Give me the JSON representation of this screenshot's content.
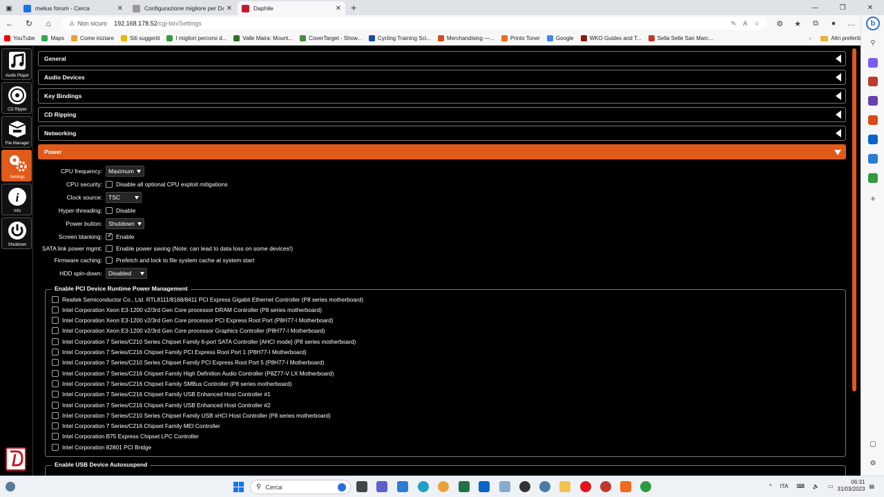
{
  "browser": {
    "tabs": [
      {
        "title": "melius forum - Cerca",
        "icon_color": "#1a73e8"
      },
      {
        "title": "Configurazione migliore per Dap",
        "icon_color": "#999999"
      },
      {
        "title": "Daphile",
        "icon_color": "#c01a2a"
      }
    ],
    "new_tab": "+",
    "address": {
      "not_secure": "Non sicuro",
      "host": "192.168.178.52",
      "path": "/cgi-bin/Settings"
    },
    "bookmarks": [
      {
        "label": "YouTube",
        "color": "#ff0000"
      },
      {
        "label": "Maps",
        "color": "#34a853"
      },
      {
        "label": "Come iniziare",
        "color": "#e8a33a"
      },
      {
        "label": "Siti suggeriti",
        "color": "#f4b400"
      },
      {
        "label": "I migliori percorsi d...",
        "color": "#3a9a3a"
      },
      {
        "label": "Valle Maira: Mount...",
        "color": "#2f6e2f"
      },
      {
        "label": "CoverTarget - Show...",
        "color": "#4a8a4a"
      },
      {
        "label": "Cycling Training Sci...",
        "color": "#1a4fa0"
      },
      {
        "label": "Merchandising —...",
        "color": "#d94a1a"
      },
      {
        "label": "Printo Toner",
        "color": "#f26a1a"
      },
      {
        "label": "Google",
        "color": "#4285f4"
      },
      {
        "label": "WKO Guides and T...",
        "color": "#8a1a1a"
      },
      {
        "label": "Sella Selle San Marc...",
        "color": "#c0392b"
      }
    ],
    "other_bookmarks": "Altri preferiti"
  },
  "nav": {
    "items": [
      {
        "label": "Audio Player",
        "icon": "music-note-icon"
      },
      {
        "label": "CD Ripper",
        "icon": "disc-icon"
      },
      {
        "label": "File Manager",
        "icon": "drive-icon"
      },
      {
        "label": "Settings",
        "icon": "gears-icon",
        "active": true
      },
      {
        "label": "Info",
        "icon": "info-icon"
      },
      {
        "label": "Shutdown",
        "icon": "power-icon"
      }
    ]
  },
  "sections": [
    {
      "title": "General"
    },
    {
      "title": "Audio Devices"
    },
    {
      "title": "Key Bindings"
    },
    {
      "title": "CD Ripping"
    },
    {
      "title": "Networking"
    },
    {
      "title": "Power",
      "open": true
    }
  ],
  "power": {
    "cpu_frequency": {
      "label": "CPU frequency:",
      "value": "Maximum"
    },
    "cpu_security": {
      "label": "CPU security:",
      "text": "Disable all optional CPU exploit mitigations",
      "checked": false
    },
    "clock_source": {
      "label": "Clock source:",
      "value": "TSC"
    },
    "hyper_threading": {
      "label": "Hyper-threading:",
      "text": "Disable",
      "checked": false
    },
    "power_button": {
      "label": "Power button:",
      "value": "Shutdown"
    },
    "screen_blanking": {
      "label": "Screen blanking:",
      "text": "Enable",
      "checked": true
    },
    "sata_link": {
      "label": "SATA link power mgmt:",
      "text": "Enable power saving (Note: can lead to data loss on some devices!)",
      "checked": false
    },
    "firmware_caching": {
      "label": "Firmware caching:",
      "text": "Prefetch and lock to file system cache at system start",
      "checked": false
    },
    "hdd_spin_down": {
      "label": "HDD spin-down:",
      "value": "Disabled"
    }
  },
  "pci": {
    "legend": "Enable PCI Device Runtime Power Management",
    "devices": [
      "Realtek Semiconductor Co., Ltd. RTL8111/8168/8411 PCI Express Gigabit Ethernet Controller (P8 series motherboard)",
      "Intel Corporation Xeon E3-1200 v2/3rd Gen Core processor DRAM Controller (P8 series motherboard)",
      "Intel Corporation Xeon E3-1200 v2/3rd Gen Core processor PCI Express Root Port (P8H77-I Motherboard)",
      "Intel Corporation Xeon E3-1200 v2/3rd Gen Core processor Graphics Controller (P8H77-I Motherboard)",
      "Intel Corporation 7 Series/C210 Series Chipset Family 6-port SATA Controller [AHCI mode] (P8 series motherboard)",
      "Intel Corporation 7 Series/C216 Chipset Family PCI Express Root Port 1 (P8H77-I Motherboard)",
      "Intel Corporation 7 Series/C210 Series Chipset Family PCI Express Root Port 5 (P8H77-I Motherboard)",
      "Intel Corporation 7 Series/C216 Chipset Family High Definition Audio Controller (P8Z77-V LX Motherboard)",
      "Intel Corporation 7 Series/C216 Chipset Family SMBus Controller (P8 series motherboard)",
      "Intel Corporation 7 Series/C216 Chipset Family USB Enhanced Host Controller #1",
      "Intel Corporation 7 Series/C216 Chipset Family USB Enhanced Host Controller #2",
      "Intel Corporation 7 Series/C210 Series Chipset Family USB xHCI Host Controller (P8 series motherboard)",
      "Intel Corporation 7 Series/C216 Chipset Family MEI Controller",
      "Intel Corporation B75 Express Chipset LPC Controller",
      "Intel Corporation 82801 PCI Bridge"
    ]
  },
  "usb": {
    "legend": "Enable USB Device Autosuspend"
  },
  "taskbar": {
    "search_placeholder": "Cerca",
    "language": "ITA",
    "time": "06:31",
    "date": "31/03/2023"
  }
}
